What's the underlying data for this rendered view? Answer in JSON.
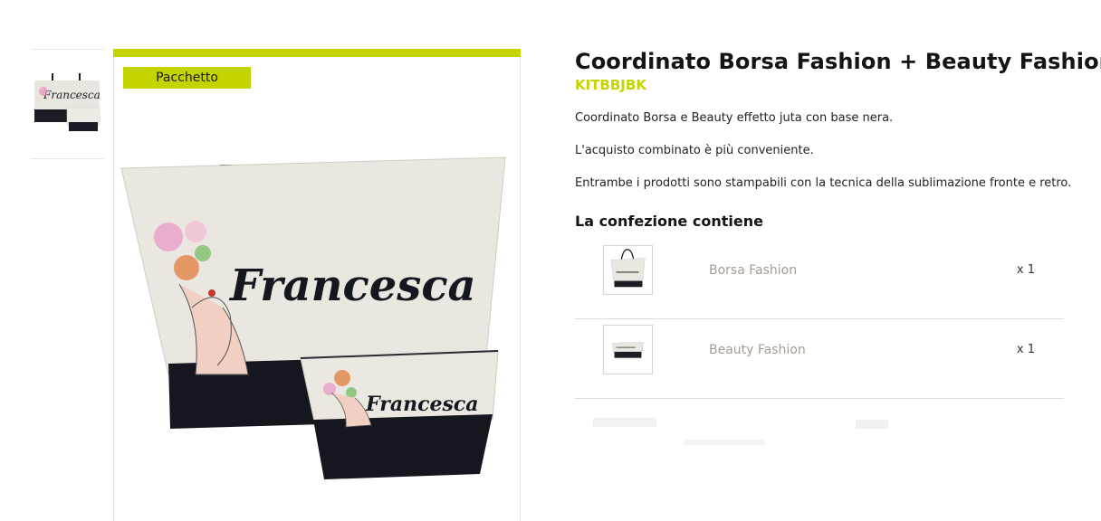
{
  "gallery": {
    "thumbnail_name": "Francesca",
    "badge_label": "Pacchetto",
    "bag_print": "Francesca",
    "pouch_print": "Francesca"
  },
  "product": {
    "title": "Coordinato Borsa Fashion + Beauty Fashion",
    "sku": "KITBBJBK",
    "description": [
      "Coordinato Borsa e Beauty effetto juta con base nera.",
      "L'acquisto combinato è più conveniente.",
      "Entrambe i prodotti sono stampabili con la tecnica della sublimazione fronte e retro."
    ],
    "package_title": "La confezione contiene",
    "package_items": [
      {
        "name": "Borsa Fashion",
        "qty": "x 1"
      },
      {
        "name": "Beauty Fashion",
        "qty": "x 1"
      }
    ]
  },
  "colors": {
    "accent": "#c4d400",
    "item_name": "#a49d90"
  }
}
